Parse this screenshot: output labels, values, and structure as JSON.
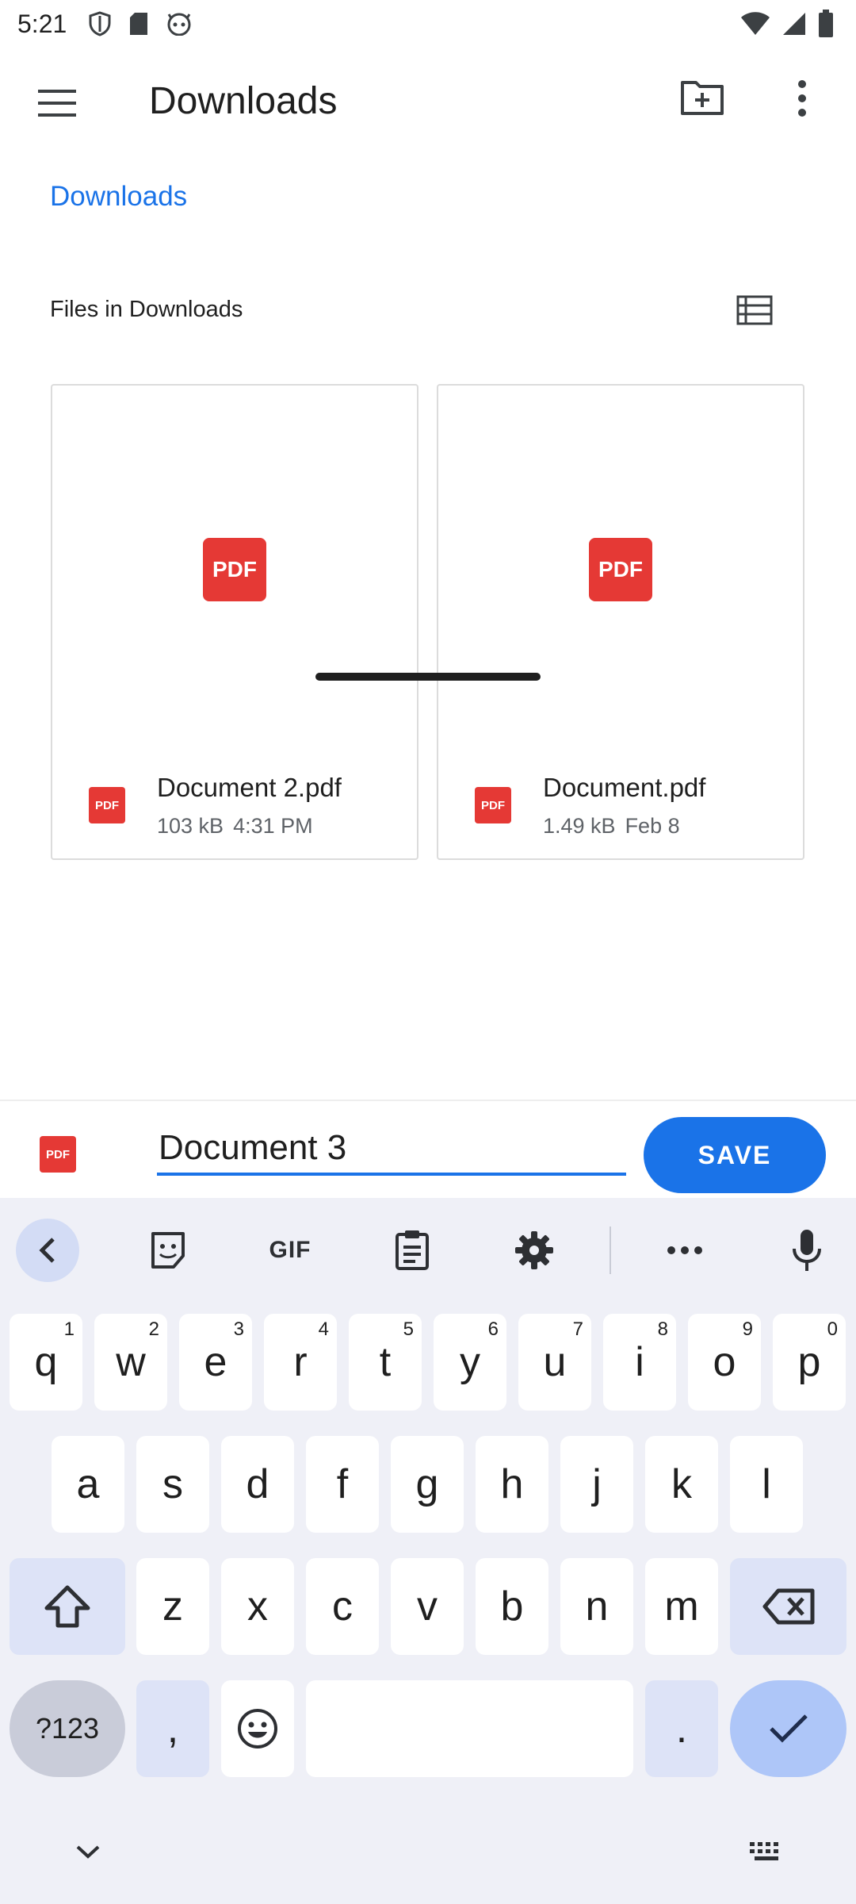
{
  "status_bar": {
    "time": "5:21",
    "left_icons": [
      "shield-icon",
      "sd-card-icon",
      "android-face-icon"
    ],
    "right_icons": [
      "wifi-icon",
      "signal-icon",
      "battery-icon"
    ]
  },
  "app_bar": {
    "title": "Downloads",
    "icons": [
      "menu-icon",
      "new-folder-icon",
      "more-vert-icon"
    ]
  },
  "breadcrumb": "Downloads",
  "section": {
    "header": "Files in Downloads",
    "view_icon": "list-view-icon"
  },
  "files": [
    {
      "name": "Document 2.pdf",
      "size": "103 kB",
      "date": "4:31 PM",
      "thumb_label": "PDF",
      "icon_label": "PDF"
    },
    {
      "name": "Document.pdf",
      "size": "1.49 kB",
      "date": "Feb 8",
      "thumb_label": "PDF",
      "icon_label": "PDF"
    }
  ],
  "save_bar": {
    "icon_label": "PDF",
    "filename": "Document 3",
    "save_label": "SAVE"
  },
  "keyboard": {
    "toolbar": [
      "back-icon",
      "sticker-icon",
      "GIF",
      "clipboard-icon",
      "settings-icon",
      "more-horiz-icon",
      "mic-icon"
    ],
    "gif_label": "GIF",
    "row1": [
      {
        "key": "q",
        "sup": "1"
      },
      {
        "key": "w",
        "sup": "2"
      },
      {
        "key": "e",
        "sup": "3"
      },
      {
        "key": "r",
        "sup": "4"
      },
      {
        "key": "t",
        "sup": "5"
      },
      {
        "key": "y",
        "sup": "6"
      },
      {
        "key": "u",
        "sup": "7"
      },
      {
        "key": "i",
        "sup": "8"
      },
      {
        "key": "o",
        "sup": "9"
      },
      {
        "key": "p",
        "sup": "0"
      }
    ],
    "row2": [
      "a",
      "s",
      "d",
      "f",
      "g",
      "h",
      "j",
      "k",
      "l"
    ],
    "row3": [
      "z",
      "x",
      "c",
      "v",
      "b",
      "n",
      "m"
    ],
    "symbols_label": "?123",
    "comma": ",",
    "period": ".",
    "accent_color": "#1a73e8",
    "pdf_color": "#e53935"
  }
}
